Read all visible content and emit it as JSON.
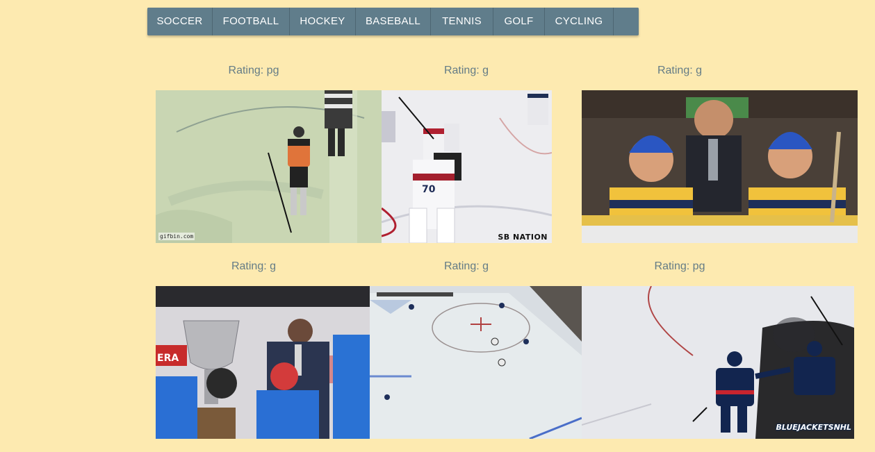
{
  "nav": {
    "items": [
      {
        "label": "SOCCER"
      },
      {
        "label": "FOOTBALL"
      },
      {
        "label": "HOCKEY"
      },
      {
        "label": "BASEBALL"
      },
      {
        "label": "TENNIS"
      },
      {
        "label": "GOLF"
      },
      {
        "label": "CYCLING"
      },
      {
        "label": ""
      }
    ]
  },
  "gifs": [
    {
      "rating": "Rating: pg",
      "watermark": "gifbin.com"
    },
    {
      "rating": "Rating: g",
      "watermark": "SB NATION"
    },
    {
      "rating": "Rating: g",
      "watermark": ""
    },
    {
      "rating": "Rating: g",
      "watermark": ""
    },
    {
      "rating": "Rating: g",
      "watermark": ""
    },
    {
      "rating": "Rating: pg",
      "watermark": "BLUEJACKETSNHL"
    }
  ],
  "colors": {
    "background": "#fdeab0",
    "nav": "#607d8b",
    "rating_text": "#647c86"
  }
}
